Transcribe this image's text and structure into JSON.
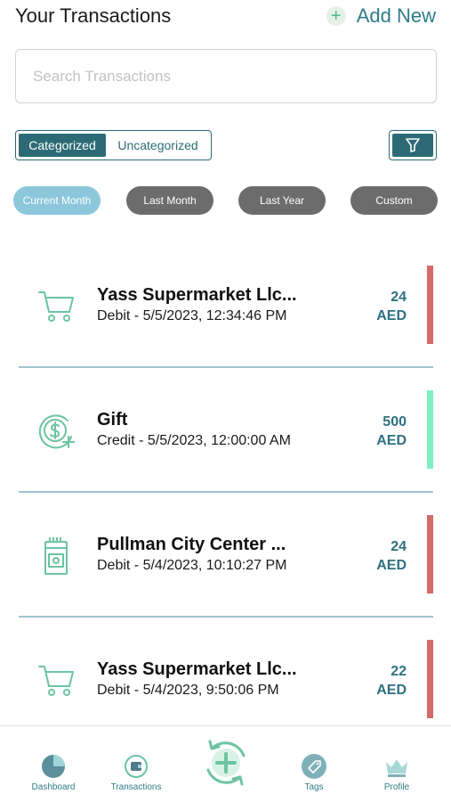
{
  "header": {
    "title": "Your Transactions",
    "add_new_label": "Add New"
  },
  "search": {
    "placeholder": "Search Transactions",
    "value": ""
  },
  "segmented": {
    "options": [
      "Categorized",
      "Uncategorized"
    ],
    "selected": "Categorized"
  },
  "periods": [
    "Current Month",
    "Last Month",
    "Last Year",
    "Custom"
  ],
  "periods_selected": "Current Month",
  "transactions": [
    {
      "name": "Yass Supermarket Llc...",
      "type": "Debit",
      "datetime": "5/5/2023, 12:34:46 PM",
      "meta": "Debit - 5/5/2023, 12:34:46 PM",
      "amount": "24",
      "currency": "AED",
      "icon": "shopping-cart-icon",
      "status_color": "#d46a6a"
    },
    {
      "name": "Gift",
      "type": "Credit",
      "datetime": "5/5/2023, 12:00:00 AM",
      "meta": "Credit - 5/5/2023, 12:00:00 AM",
      "amount": "500",
      "currency": "AED",
      "icon": "money-plus-icon",
      "status_color": "#7ff0c3"
    },
    {
      "name": "Pullman City Center ...",
      "type": "Debit",
      "datetime": "5/4/2023, 10:10:27 PM",
      "meta": "Debit - 5/4/2023, 10:10:27 PM",
      "amount": "24",
      "currency": "AED",
      "icon": "cigarette-pack-icon",
      "status_color": "#d46a6a"
    },
    {
      "name": "Yass Supermarket Llc...",
      "type": "Debit",
      "datetime": "5/4/2023, 9:50:06 PM",
      "meta": "Debit - 5/4/2023, 9:50:06 PM",
      "amount": "22",
      "currency": "AED",
      "icon": "shopping-cart-icon",
      "status_color": "#d46a6a"
    }
  ],
  "bottom_nav": {
    "items": [
      {
        "label": "Dashboard",
        "icon": "pie-chart-icon"
      },
      {
        "label": "Transactions",
        "icon": "wallet-sync-icon"
      },
      {
        "label": "Tags",
        "icon": "tag-icon"
      },
      {
        "label": "Profile",
        "icon": "crown-icon"
      }
    ],
    "center_icon": "add-sync-icon"
  },
  "colors": {
    "accent": "#2c6b75",
    "teal_text": "#2f7d87",
    "debit": "#d46a6a",
    "credit": "#7ff0c3",
    "pill_active": "#8cc7dc",
    "pill_inactive": "#6c6c6c"
  }
}
